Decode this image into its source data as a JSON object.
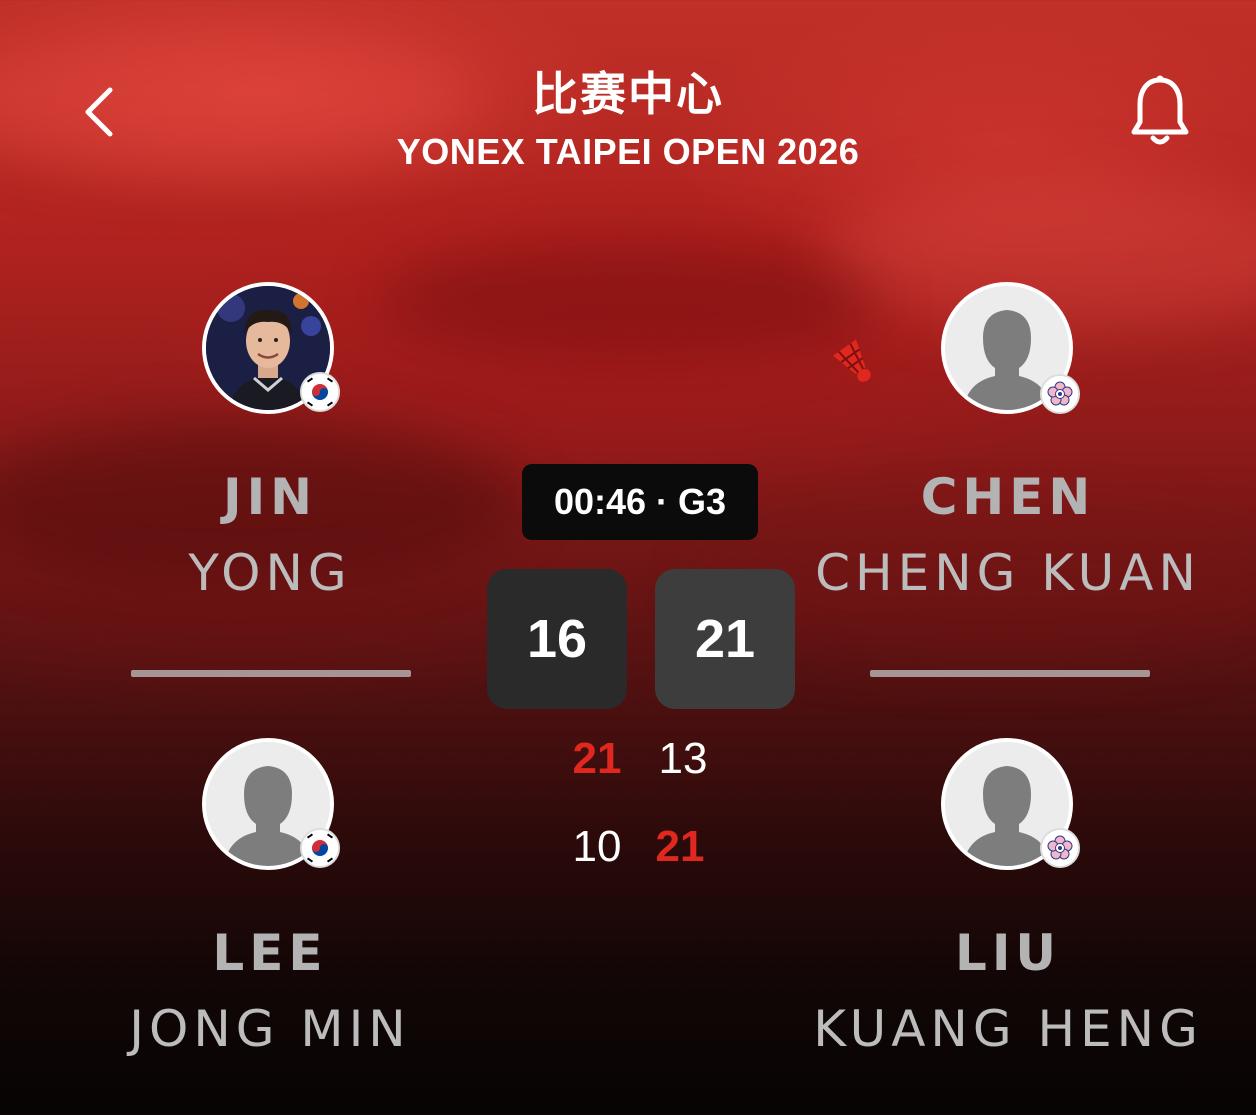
{
  "header": {
    "title": "比赛中心",
    "subtitle": "YONEX TAIPEI OPEN 2026"
  },
  "match": {
    "timer": "00:46 · G3",
    "current_game": {
      "left": "16",
      "right": "21"
    },
    "completed_games": [
      {
        "left": "21",
        "right": "13",
        "winner": "left"
      },
      {
        "left": "10",
        "right": "21",
        "winner": "right"
      }
    ]
  },
  "players": {
    "left_top": {
      "surname": "JIN",
      "given": "YONG",
      "country": "KOR"
    },
    "left_bottom": {
      "surname": "LEE",
      "given": "JONG MIN",
      "country": "KOR"
    },
    "right_top": {
      "surname": "CHEN",
      "given": "CHENG KUAN",
      "country": "TPE",
      "serving": true
    },
    "right_bottom": {
      "surname": "LIU",
      "given": "KUANG HENG",
      "country": "TPE"
    }
  },
  "icons": {
    "back": "chevron-left-icon",
    "notifications": "bell-icon",
    "serve": "shuttlecock-icon"
  },
  "colors": {
    "accent": "#e0281e",
    "score_box_left": "#2a2a2a",
    "score_box_right": "#3d3d3d",
    "timer_bg": "#0b0b0b"
  }
}
